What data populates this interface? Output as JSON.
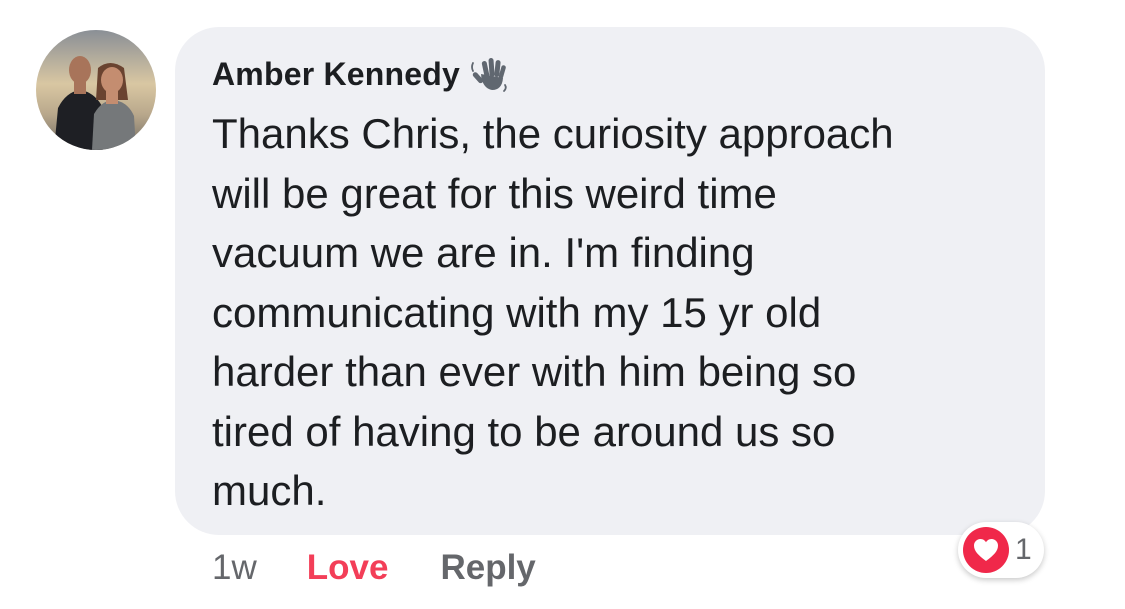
{
  "comment": {
    "author": "Amber Kennedy",
    "author_badge_icon": "waving-hand-icon",
    "text": "Thanks Chris, the curiosity approach\nwill be great for this weird time\nvacuum we are in. I'm finding\ncommunicating with my 15 yr old\nharder than ever with him being so\ntired of having to be around us so\nmuch.",
    "bubble_color": "#eff0f4"
  },
  "actions": {
    "timestamp": "1w",
    "love_label": "Love",
    "love_color": "#f33e58",
    "reply_label": "Reply"
  },
  "reactions": {
    "icon": "heart-icon",
    "count": "1",
    "color": "#f0284a"
  }
}
